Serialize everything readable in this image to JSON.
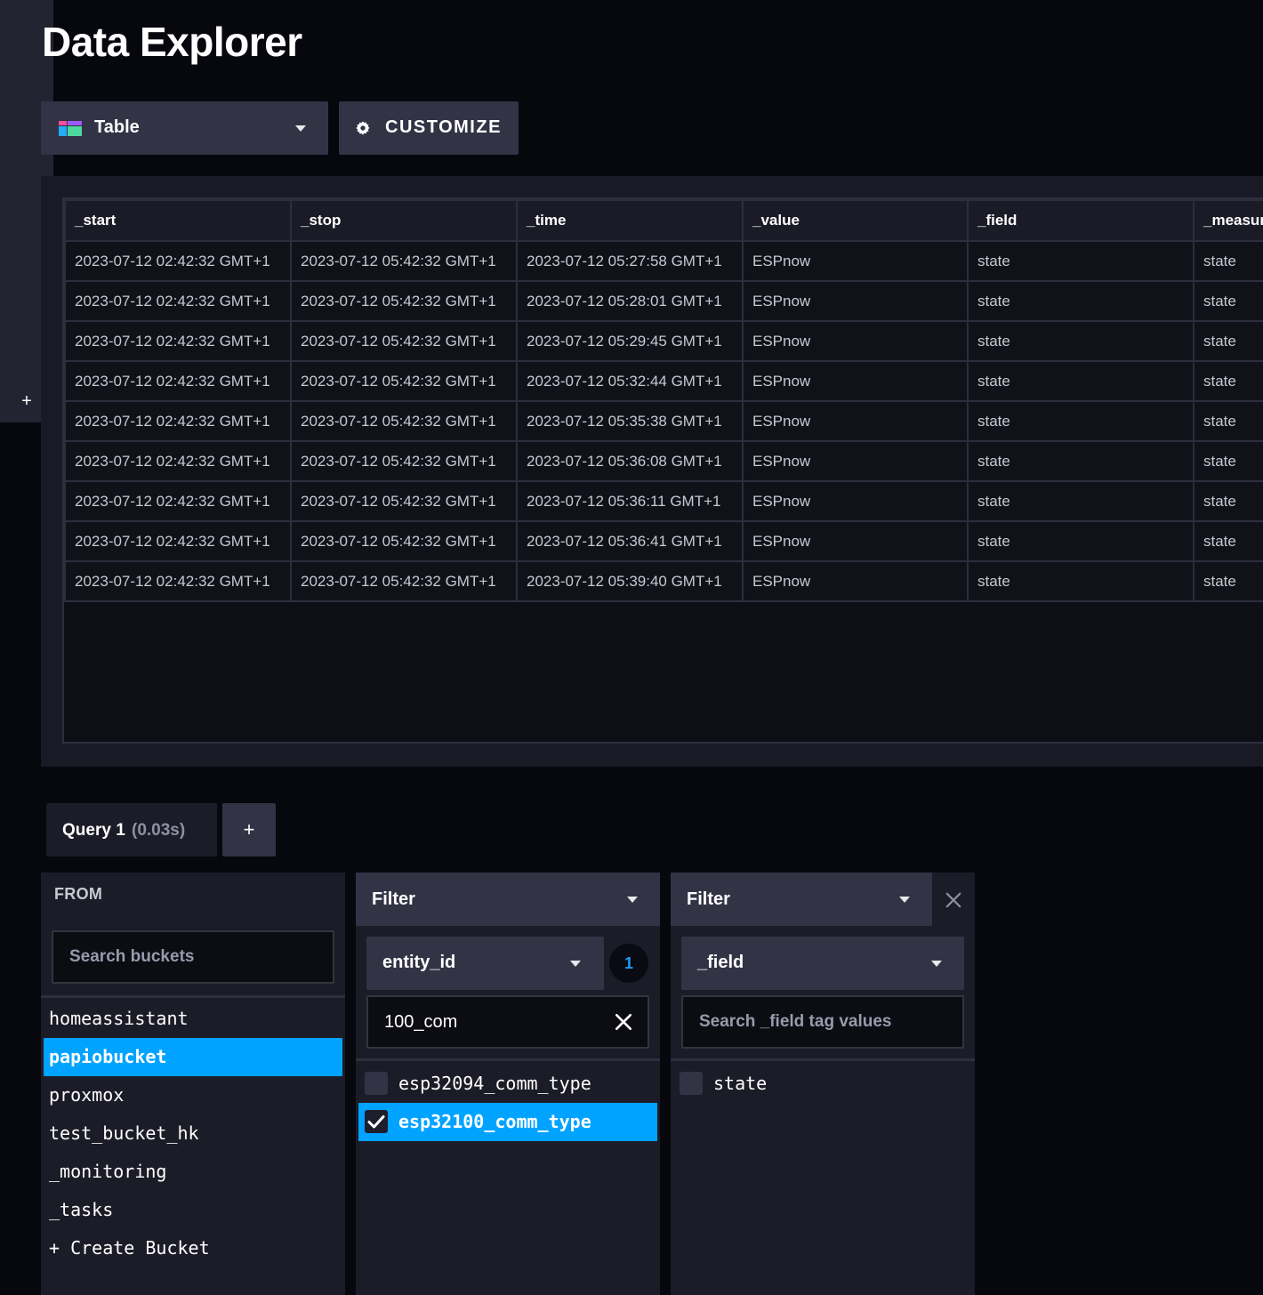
{
  "page": {
    "title": "Data Explorer"
  },
  "toolbar": {
    "viz_type": "Table",
    "customize_label": "CUSTOMIZE",
    "viz_icon_colors": [
      "#ff4d9e",
      "#9d5bff",
      "#22adf6",
      "#4ed8a0"
    ]
  },
  "table": {
    "columns": [
      "_start",
      "_stop",
      "_time",
      "_value",
      "_field",
      "_measur"
    ],
    "rows": [
      [
        "2023-07-12 02:42:32 GMT+1",
        "2023-07-12 05:42:32 GMT+1",
        "2023-07-12 05:27:58 GMT+1",
        "ESPnow",
        "state",
        "state"
      ],
      [
        "2023-07-12 02:42:32 GMT+1",
        "2023-07-12 05:42:32 GMT+1",
        "2023-07-12 05:28:01 GMT+1",
        "ESPnow",
        "state",
        "state"
      ],
      [
        "2023-07-12 02:42:32 GMT+1",
        "2023-07-12 05:42:32 GMT+1",
        "2023-07-12 05:29:45 GMT+1",
        "ESPnow",
        "state",
        "state"
      ],
      [
        "2023-07-12 02:42:32 GMT+1",
        "2023-07-12 05:42:32 GMT+1",
        "2023-07-12 05:32:44 GMT+1",
        "ESPnow",
        "state",
        "state"
      ],
      [
        "2023-07-12 02:42:32 GMT+1",
        "2023-07-12 05:42:32 GMT+1",
        "2023-07-12 05:35:38 GMT+1",
        "ESPnow",
        "state",
        "state"
      ],
      [
        "2023-07-12 02:42:32 GMT+1",
        "2023-07-12 05:42:32 GMT+1",
        "2023-07-12 05:36:08 GMT+1",
        "ESPnow",
        "state",
        "state"
      ],
      [
        "2023-07-12 02:42:32 GMT+1",
        "2023-07-12 05:42:32 GMT+1",
        "2023-07-12 05:36:11 GMT+1",
        "ESPnow",
        "state",
        "state"
      ],
      [
        "2023-07-12 02:42:32 GMT+1",
        "2023-07-12 05:42:32 GMT+1",
        "2023-07-12 05:36:41 GMT+1",
        "ESPnow",
        "state",
        "state"
      ],
      [
        "2023-07-12 02:42:32 GMT+1",
        "2023-07-12 05:42:32 GMT+1",
        "2023-07-12 05:39:40 GMT+1",
        "ESPnow",
        "state",
        "state"
      ]
    ]
  },
  "query": {
    "tab_label": "Query 1",
    "tab_time": "(0.03s)",
    "add_label": "+"
  },
  "from_card": {
    "title": "FROM",
    "search_placeholder": "Search buckets",
    "buckets": [
      "homeassistant",
      "papiobucket",
      "proxmox",
      "test_bucket_hk",
      "_monitoring",
      "_tasks",
      "+ Create Bucket"
    ],
    "selected": "papiobucket"
  },
  "filter1": {
    "function": "Filter",
    "key": "entity_id",
    "selected_count": "1",
    "search_value": "100_com",
    "values": [
      {
        "label": "esp32094_comm_type",
        "checked": false
      },
      {
        "label": "esp32100_comm_type",
        "checked": true
      }
    ]
  },
  "filter2": {
    "function": "Filter",
    "key": "_field",
    "search_placeholder": "Search _field tag values",
    "values": [
      {
        "label": "state",
        "checked": false
      }
    ]
  },
  "add_card": {
    "label": "+"
  },
  "colors": {
    "accent": "#00a3ff",
    "panel": "#1c1c28",
    "control": "#333346",
    "background": "#07070e"
  }
}
